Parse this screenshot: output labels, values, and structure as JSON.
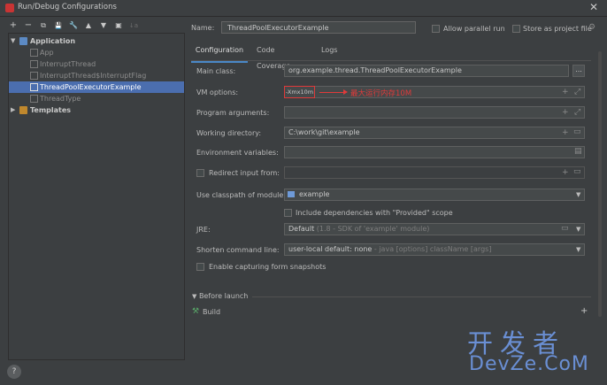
{
  "window": {
    "title": "Run/Debug Configurations"
  },
  "toolbar": {
    "add": "+",
    "remove": "−",
    "copy": "⧉",
    "save": "💾",
    "edit": "🔧",
    "up": "▲",
    "down": "▼",
    "folder": "▣",
    "sort": "↓a"
  },
  "tree": {
    "application": "Application",
    "children": [
      "App",
      "InterruptThread",
      "InterruptThread$InterruptFlag",
      "ThreadPoolExecutorExample",
      "ThreadType"
    ],
    "templates": "Templates"
  },
  "name": {
    "label": "Name:",
    "value": "ThreadPoolExecutorExample"
  },
  "options": {
    "parallel": "Allow parallel run",
    "store": "Store as project file"
  },
  "tabs": [
    "Configuration",
    "Code Coverage",
    "Logs"
  ],
  "form": {
    "main_class_label": "Main class:",
    "main_class_value": "org.example.thread.ThreadPoolExecutorExample",
    "vm_label": "VM options:",
    "vm_value": "-Xmx10m",
    "vm_annotation": "最大运行内存10M",
    "program_label": "Program arguments:",
    "workdir_label": "Working directory:",
    "workdir_value": "C:\\work\\git\\example",
    "env_label": "Environment variables:",
    "redirect_label": "Redirect input from:",
    "classpath_label": "Use classpath of module:",
    "classpath_value": "example",
    "include_provided": "Include dependencies with \"Provided\" scope",
    "jre_label": "JRE:",
    "jre_value": "Default",
    "jre_hint": "(1.8 - SDK of 'example' module)",
    "shorten_label": "Shorten command line:",
    "shorten_value": "user-local default: none",
    "shorten_hint": "- java [options] className [args]",
    "snapshots": "Enable capturing form snapshots"
  },
  "before_launch": {
    "label": "Before launch",
    "build": "Build"
  },
  "help": "?",
  "watermark": {
    "line1": "开发者",
    "line2": "DevZe.CoM"
  }
}
